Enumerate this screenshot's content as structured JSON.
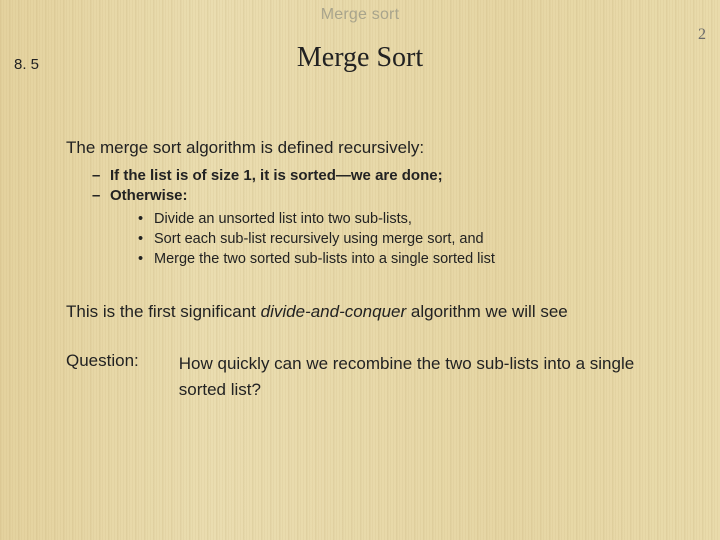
{
  "kicker": "Merge sort",
  "page_number": "2",
  "section_number": "8. 5",
  "title": "Merge Sort",
  "lead": "The merge sort algorithm is defined recursively:",
  "dash_items": [
    "If the list is of size 1, it is sorted—we are done;",
    "Otherwise:"
  ],
  "sub_bullets": [
    "Divide an unsorted list into two sub-lists,",
    "Sort each sub-list recursively using merge sort, and",
    "Merge the two sorted sub-lists into a single sorted list"
  ],
  "para2_pre": "This is the first significant ",
  "para2_em": "divide-and-conquer",
  "para2_post": " algorithm we will see",
  "question_label": "Question:",
  "question_text": "How quickly can we recombine the two sub-lists into a single sorted list?"
}
